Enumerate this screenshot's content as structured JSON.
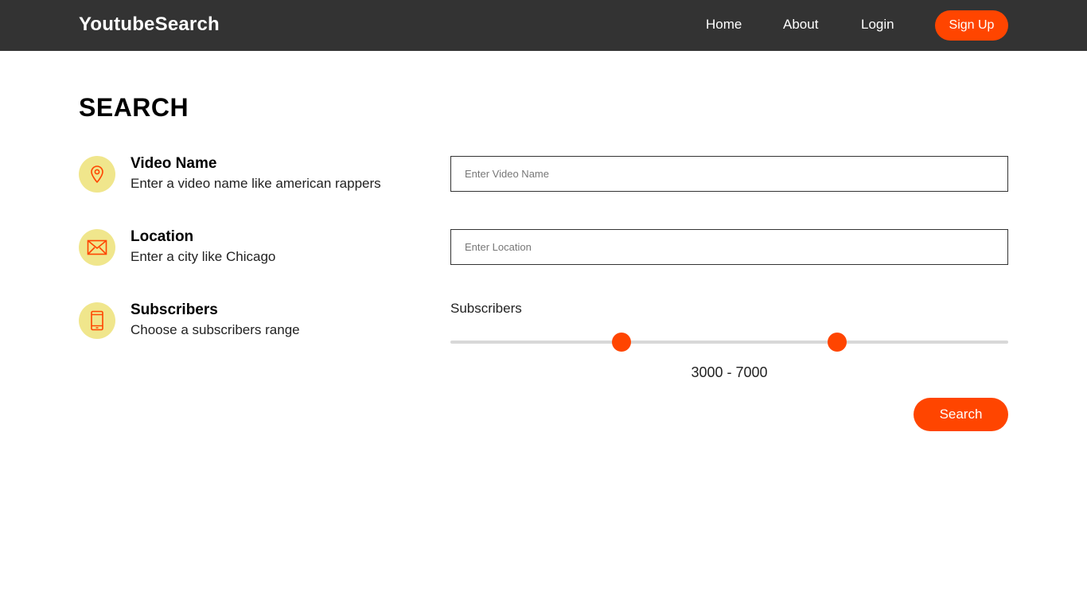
{
  "nav": {
    "brand": "YoutubeSearch",
    "links": [
      "Home",
      "About",
      "Login"
    ],
    "signup": "Sign Up"
  },
  "page": {
    "title": "SEARCH"
  },
  "rows": [
    {
      "icon": "location-pin-icon",
      "title": "Video Name",
      "desc": "Enter a video name like american rappers"
    },
    {
      "icon": "envelope-icon",
      "title": "Location",
      "desc": "Enter a city like Chicago"
    },
    {
      "icon": "phone-icon",
      "title": "Subscribers",
      "desc": "Choose a subscribers range"
    }
  ],
  "fields": {
    "video_placeholder": "Enter Video Name",
    "location_placeholder": "Enter Location"
  },
  "subscribers": {
    "label": "Subscribers",
    "range_text": "3000 - 7000",
    "min_fraction": 0.307,
    "max_fraction": 0.693
  },
  "search_button": "Search",
  "colors": {
    "accent": "#ff4500",
    "navbar": "#333333",
    "icon_bg": "#f0e68c"
  }
}
